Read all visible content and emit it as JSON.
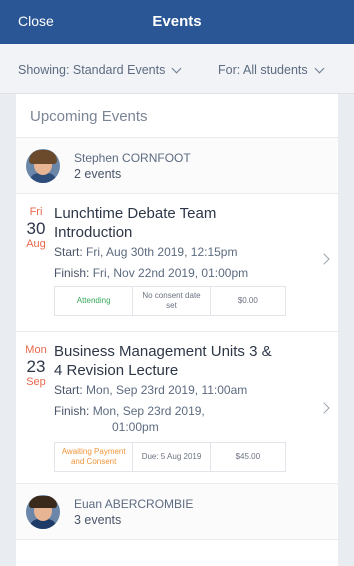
{
  "header": {
    "close_label": "Close",
    "title": "Events"
  },
  "filters": {
    "showing": "Showing: Standard Events",
    "for": "For: All students"
  },
  "panel": {
    "title": "Upcoming Events"
  },
  "people": [
    {
      "name": "Stephen CORNFOOT",
      "count": "2 events",
      "events": [
        {
          "dow": "Fri",
          "day": "30",
          "month": "Aug",
          "title": "Lunchtime Debate Team Introduction",
          "start_label": "Start:",
          "start": "Fri, Aug 30th 2019, 12:15pm",
          "finish_label": "Finish:",
          "finish": "Fri, Nov 22nd 2019, 01:00pm",
          "status": "Attending",
          "consent": "No consent date set",
          "cost": "$0.00"
        },
        {
          "dow": "Mon",
          "day": "23",
          "month": "Sep",
          "title": "Business Management Units 3 & 4 Revision Lecture",
          "start_label": "Start:",
          "start": "Mon, Sep 23rd 2019, 11:00am",
          "finish_label": "Finish:",
          "finish_line1": "Mon, Sep 23rd 2019,",
          "finish_line2": "01:00pm",
          "status": "Awaiting Payment and Consent",
          "due": "Due: 5 Aug 2019",
          "cost": "$45.00"
        }
      ]
    },
    {
      "name": "Euan ABERCROMBIE",
      "count": "3 events"
    }
  ],
  "colors": {
    "header_bg": "#2b5695",
    "date_accent": "#e8674d",
    "attending": "#39a85a",
    "awaiting": "#f0953a"
  }
}
